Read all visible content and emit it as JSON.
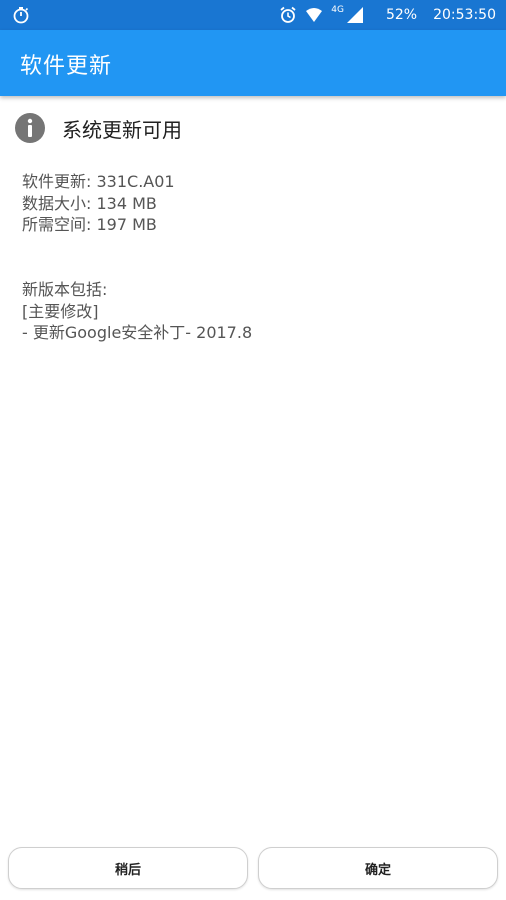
{
  "status_bar": {
    "left_icon": "stopwatch-icon",
    "alarm_icon": "alarm-clock-icon",
    "wifi_icon": "wifi-icon",
    "network_label": "4G",
    "signal_icon": "signal-icon",
    "battery": "52%",
    "time": "20:53:50"
  },
  "app_bar": {
    "title": "软件更新"
  },
  "update": {
    "icon": "info-icon",
    "title": "系统更新可用",
    "details": [
      "软件更新: 331C.A01",
      "数据大小: 134 MB",
      "所需空间: 197 MB"
    ],
    "notes": [
      "新版本包括:",
      "[主要修改]",
      "- 更新Google安全补丁- 2017.8"
    ]
  },
  "buttons": {
    "later": "稍后",
    "ok": "确定"
  },
  "colors": {
    "status_bar": "#1976d2",
    "app_bar": "#2196f3",
    "text": "#555555",
    "icon": "#757575"
  }
}
